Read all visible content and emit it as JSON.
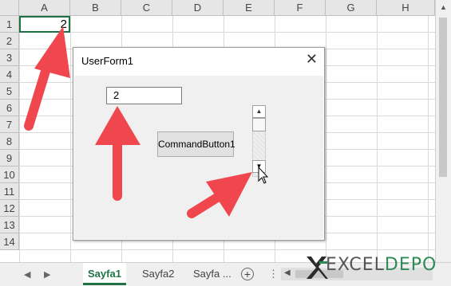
{
  "sheet": {
    "columns": [
      "A",
      "B",
      "C",
      "D",
      "E",
      "F",
      "G",
      "H"
    ],
    "rows": [
      "1",
      "2",
      "3",
      "4",
      "5",
      "6",
      "7",
      "8",
      "9",
      "10",
      "11",
      "12",
      "13",
      "14"
    ],
    "cell_a1": "2"
  },
  "tabs": {
    "items": [
      "Sayfa1",
      "Sayfa2",
      "Sayfa ..."
    ],
    "active": "Sayfa1",
    "add_symbol": "+",
    "more_symbol": "⋮"
  },
  "userform": {
    "title": "UserForm1",
    "close_symbol": "✕",
    "textbox_value": "2",
    "button_label": "CommandButton1"
  },
  "watermark": {
    "excel": "EXCEL",
    "depo": "DEPO"
  },
  "colors": {
    "arrow": "#f0474f",
    "excel_green": "#217346"
  }
}
